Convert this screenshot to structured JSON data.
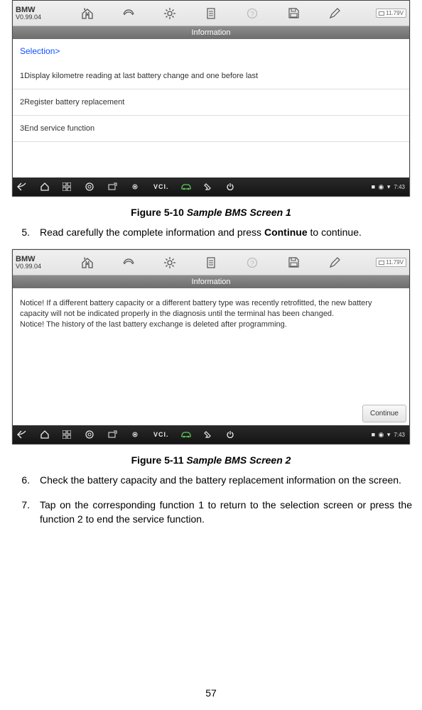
{
  "app": {
    "brand_name": "BMW",
    "brand_ver": "V0.99.04",
    "voltage": "11.79V",
    "title": "Information",
    "breadcrumb": "Selection>",
    "menu_items": [
      "1Display kilometre reading at last battery change and one before last",
      "2Register battery replacement",
      "3End service function"
    ],
    "notice_body": "Notice! If a different battery capacity or a different battery type was recently retrofitted, the new battery capacity will not be indicated properly in the diagnosis until the terminal has been changed.\nNotice! The history of the last battery exchange is deleted after programming.",
    "continue_label": "Continue",
    "time": "7:43"
  },
  "captions": {
    "fig1_num": "Figure 5-10",
    "fig1_title": " Sample BMS Screen 1",
    "fig2_num": "Figure 5-11",
    "fig2_title": " Sample BMS Screen 2"
  },
  "steps": {
    "s5_num": "5.",
    "s5_txt_a": "Read carefully the complete information and press ",
    "s5_bold": "Continue",
    "s5_txt_b": " to continue.",
    "s6_num": "6.",
    "s6_txt": "Check the battery capacity and the battery replacement information on the screen.",
    "s7_num": "7.",
    "s7_txt": "Tap on the corresponding function 1 to return to the selection screen or press the function 2 to end the service function."
  },
  "page_number": "57"
}
